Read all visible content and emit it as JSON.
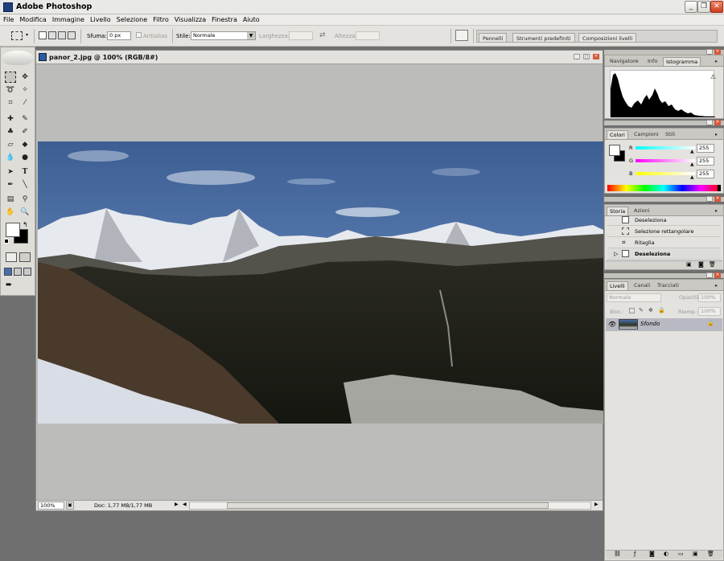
{
  "titlebar": {
    "title": "Adobe Photoshop",
    "minimize": "_",
    "restore": "❐",
    "close": "✕"
  },
  "menu": [
    "File",
    "Modifica",
    "Immagine",
    "Livello",
    "Selezione",
    "Filtro",
    "Visualizza",
    "Finestra",
    "Aiuto"
  ],
  "options": {
    "feather_label": "Sfuma:",
    "feather_value": "0 px",
    "antialias_label": "Antialias",
    "style_label": "Stile:",
    "style_value": "Normale",
    "width_label": "Larghezza:",
    "height_label": "Altezza:"
  },
  "palette_well_tabs": [
    "Pennelli",
    "Strumenti predefiniti",
    "Composizioni livelli"
  ],
  "document": {
    "title": "panor_2.jpg @ 100% (RGB/8#)",
    "zoom": "100%",
    "doc_size": "Doc: 1,77 MB/1,77 MB"
  },
  "navigator_panel": {
    "tabs": [
      "Navigatore",
      "Info",
      "Istogramma"
    ],
    "active": "Istogramma",
    "warning": "⚠"
  },
  "color_panel": {
    "tabs": [
      "Colori",
      "Campioni",
      "Stili"
    ],
    "active": "Colori",
    "r_label": "R",
    "g_label": "G",
    "b_label": "B",
    "r": "255",
    "g": "255",
    "b": "255"
  },
  "history_panel": {
    "tabs": [
      "Storia",
      "Azioni"
    ],
    "active": "Storia",
    "items": [
      "Deseleziona",
      "Selezione rettangolare",
      "Ritaglia",
      "Deseleziona"
    ]
  },
  "layers_panel": {
    "tabs": [
      "Livelli",
      "Canali",
      "Tracciati"
    ],
    "active": "Livelli",
    "blend_mode": "Normale",
    "opacity_label": "Opacità:",
    "opacity_value": "100%",
    "lock_label": "Bloc.:",
    "fill_label": "Riemp.:",
    "fill_value": "100%",
    "layer_name": "Sfondo"
  },
  "colors": {
    "workspace": "#6f6f6f",
    "panel": "#e3e2de",
    "selection": "#dcdcda"
  }
}
